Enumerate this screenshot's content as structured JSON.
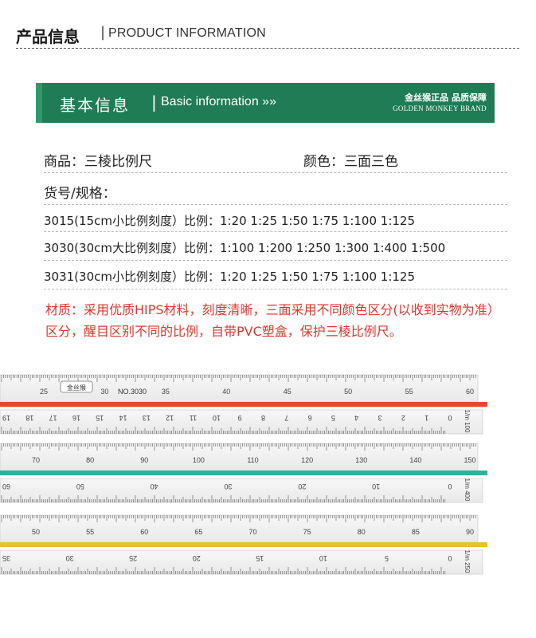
{
  "header": {
    "title_cn": "产品信息",
    "separator": "|",
    "title_en": "PRODUCT INFORMATION"
  },
  "banner": {
    "title_cn": "基本信息",
    "separator": "|",
    "title_en": "Basic information »»",
    "brand_cn": "金丝猴正品 品质保障",
    "brand_en": "GOLDEN MONKEY BRAND"
  },
  "info": {
    "product": "商品：三棱比例尺",
    "color": "颜色：三面三色",
    "model_label": "货号/规格：",
    "specs": [
      "3015(15cm小比例刻度）比例：1:20  1:25  1:50  1:75  1:100  1:125",
      "3030(30cm大比例刻度）比例：1:100  1:200  1:250  1:300  1:400  1:500",
      "3031(30cm小比例刻度）比例：1:20  1:25  1:50  1:75  1:100  1:125"
    ],
    "material_note": "材质：采用优质HIPS材料，刻度清晰，三面采用不同颜色区分(以收到实物为准）区分，醒目区别不同的比例，自带PVC塑盒，保护三棱比例尺。"
  },
  "ruler": {
    "model_label": "NO.3030",
    "logo_text": "金丝猴",
    "faces": [
      {
        "stripe_color": "#e8452f",
        "upper_labels": [
          "25",
          "30",
          "35",
          "40",
          "45",
          "50",
          "55",
          "60"
        ],
        "lower_labels": [
          "19",
          "18",
          "17",
          "16",
          "15",
          "14",
          "13",
          "12",
          "11",
          "10",
          "9",
          "8",
          "7",
          "6",
          "5",
          "4",
          "3",
          "2",
          "1",
          "0"
        ],
        "scale_label": "1/m 100"
      },
      {
        "stripe_color": "#2bb39a",
        "upper_labels": [
          "70",
          "80",
          "90",
          "100",
          "110",
          "120",
          "130",
          "140",
          "150"
        ],
        "lower_labels": [
          "60",
          "50",
          "40",
          "30",
          "20",
          "10",
          "0"
        ],
        "scale_label": "1/m 400"
      },
      {
        "stripe_color": "#e8c22a",
        "upper_labels": [
          "50",
          "55",
          "60",
          "65",
          "70",
          "75",
          "80",
          "85",
          "90"
        ],
        "lower_labels": [
          "35",
          "30",
          "25",
          "20",
          "15",
          "10",
          "5",
          "0"
        ],
        "scale_label": "1/m 250"
      }
    ]
  }
}
